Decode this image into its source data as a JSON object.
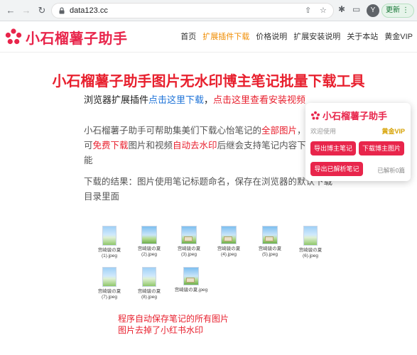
{
  "browser": {
    "url": "data123.cc",
    "avatar_letter": "Y",
    "update_label": "更新",
    "icons": [
      "back-icon",
      "forward-icon",
      "reload-icon",
      "lock-icon",
      "share-icon",
      "star-icon",
      "extension-puzzle-icon",
      "sidebar-icon",
      "more-icon"
    ]
  },
  "site": {
    "logo_text": "小石榴薯子助手",
    "nav": [
      {
        "label": "首页",
        "active": false
      },
      {
        "label": "扩展插件下载",
        "active": true
      },
      {
        "label": "价格说明",
        "active": false
      },
      {
        "label": "扩展安装说明",
        "active": false
      },
      {
        "label": "关于本站",
        "active": false
      },
      {
        "label": "黄金VIP",
        "active": false
      }
    ]
  },
  "main": {
    "title": "小石榴薯子助手图片无水印博主笔记批量下载工具",
    "sub_prefix": "浏览器扩展插件",
    "sub_link_download": "点击这里下载",
    "sub_sep": "，",
    "sub_link_video": "点击这里查看安装视频",
    "para1_a": "小石榴薯子助手可帮助集美们下载心怡笔记的",
    "para1_b": "全部图片",
    "para1_c": "，用户可",
    "para1_d": "免费下载",
    "para1_e": "图片和视频",
    "para1_f": "自动去水印",
    "para1_g": "后继会支持笔记内容下载功能",
    "para2": "下载的结果：图片使用笔记标题命名，保存在浏览器的默认下载目录里面",
    "thumbnails": [
      {
        "caption": "宫崎骏の夏\n(1).jpeg"
      },
      {
        "caption": "宫崎骏の夏\n(2).jpeg"
      },
      {
        "caption": "宫崎骏の夏\n(3).jpeg"
      },
      {
        "caption": "宫崎骏の夏\n(4).jpeg"
      },
      {
        "caption": "宫崎骏の夏\n(5).jpeg"
      },
      {
        "caption": "宫崎骏の夏\n(6).jpeg"
      },
      {
        "caption": "宫崎骏の夏\n(7).jpeg"
      },
      {
        "caption": "宫崎骏の夏\n(8).jpeg"
      },
      {
        "caption": "宫崎骏の夏.jpeg"
      }
    ],
    "note1": "程序自动保存笔记的所有图片",
    "note2": "图片去掉了小红书水印"
  },
  "popup": {
    "title": "小石榴薯子助手",
    "welcome": "欢迎使用",
    "vip": "黄金VIP",
    "btn_export_blogger": "导出博主笔记",
    "btn_download_images": "下载博主图片",
    "btn_export_parsed": "导出已解析笔记",
    "parsed_count": "已解析0篇"
  },
  "colors": {
    "brand": "#e8254b",
    "title_red": "#e8202e",
    "link_blue": "#1e73d8",
    "nav_active": "#f08c00",
    "vip_gold": "#d6a100"
  }
}
